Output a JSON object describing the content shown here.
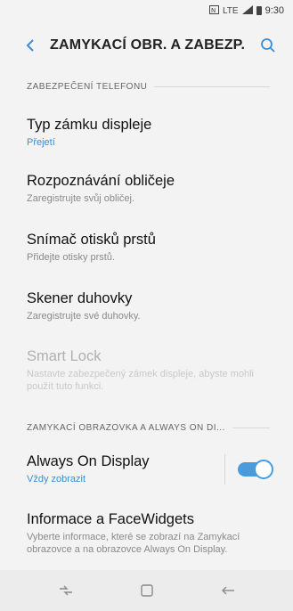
{
  "status_bar": {
    "icons": [
      "nfc-icon",
      "lte-icon",
      "signal-icon",
      "battery-icon"
    ],
    "lte_label": "LTE",
    "time": "9:30"
  },
  "header": {
    "title": "ZAMYKACÍ OBR. A ZABEZP.",
    "back_icon": "back-arrow-icon",
    "search_icon": "search-icon"
  },
  "sections": [
    {
      "title": "ZABEZPEČENÍ TELEFONU",
      "items": [
        {
          "title": "Typ zámku displeje",
          "subtitle": "Přejetí",
          "subtitle_accent": true
        },
        {
          "title": "Rozpoznávání obličeje",
          "subtitle": "Zaregistrujte svůj obličej."
        },
        {
          "title": "Snímač otisků prstů",
          "subtitle": "Přidejte otisky prstů."
        },
        {
          "title": "Skener duhovky",
          "subtitle": "Zaregistrujte své duhovky."
        },
        {
          "title": "Smart Lock",
          "subtitle": "Nastavte zabezpečený zámek displeje, abyste mohli použít tuto funkci.",
          "disabled": true
        }
      ]
    },
    {
      "title": "ZAMYKACÍ OBRAZOVKA A ALWAYS ON DI...",
      "items": [
        {
          "title": "Always On Display",
          "subtitle": "Vždy zobrazit",
          "subtitle_accent": true,
          "toggle_on": true
        },
        {
          "title": "Informace a FaceWidgets",
          "subtitle": "Vyberte informace, které se zobrazí na Zamykací obrazovce a na obrazovce Always On Display."
        }
      ]
    }
  ],
  "navbar": {
    "recent_icon": "recent-apps-icon",
    "home_icon": "home-icon",
    "back_icon": "back-icon"
  },
  "colors": {
    "accent": "#3b8dd6",
    "background": "#f3f3f3"
  }
}
